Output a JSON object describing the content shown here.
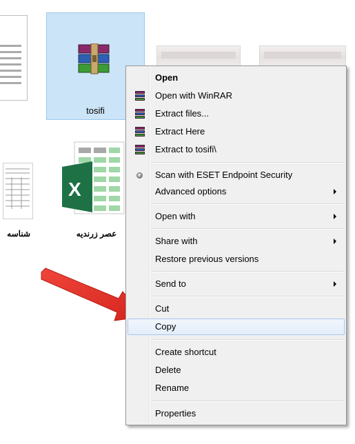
{
  "files": [
    {
      "label": "tosifi",
      "icon": "winrar-archive-icon",
      "selected": true
    },
    {
      "label": "عصر زرنديه",
      "icon": "excel-file-icon"
    },
    {
      "label": "شناسه",
      "icon": "document-thumbnail-icon"
    }
  ],
  "menu": {
    "open": "Open",
    "open_with_winrar": "Open with WinRAR",
    "extract_files": "Extract files...",
    "extract_here": "Extract Here",
    "extract_to": "Extract to tosifi\\",
    "scan_eset": "Scan with ESET Endpoint Security",
    "advanced_options": "Advanced options",
    "open_with": "Open with",
    "share_with": "Share with",
    "restore_previous": "Restore previous versions",
    "send_to": "Send to",
    "cut": "Cut",
    "copy": "Copy",
    "create_shortcut": "Create shortcut",
    "delete": "Delete",
    "rename": "Rename",
    "properties": "Properties"
  },
  "excel_glyph": "X",
  "colors": {
    "arrow": "#e8332a",
    "selection": "#cce4f7",
    "excel_green": "#1e7145"
  }
}
